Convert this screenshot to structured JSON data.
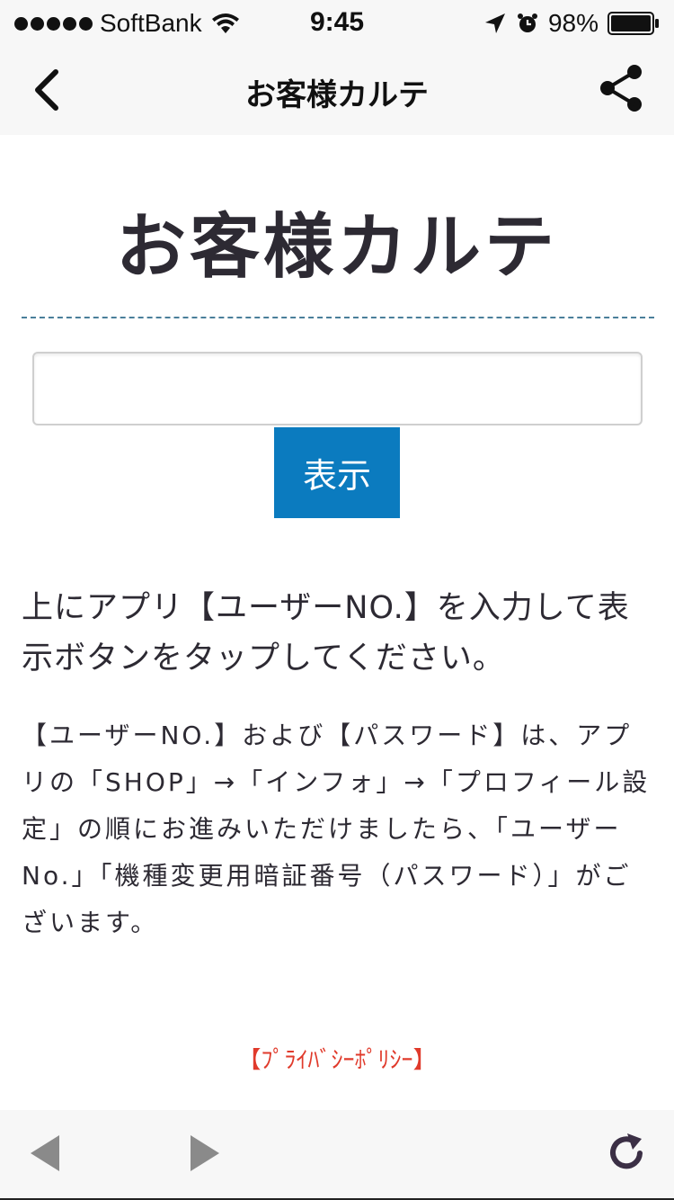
{
  "status_bar": {
    "carrier": "SoftBank",
    "time": "9:45",
    "battery": "98%",
    "signal_dots": 5,
    "icons": [
      "wifi-icon",
      "location-arrow-icon",
      "alarm-icon",
      "battery-icon"
    ]
  },
  "nav": {
    "title": "お客様カルテ",
    "back_icon": "chevron-left-icon",
    "share_icon": "share-icon"
  },
  "main": {
    "heading": "お客様カルテ",
    "input": {
      "value": "",
      "placeholder": ""
    },
    "show_button_label": "表示",
    "instruction": "上にアプリ【ユーザーNO.】を入力して表示ボタンをタップしてください。",
    "note": "【ユーザーNO.】および【パスワード】は、アプリの「SHOP」→「インフォ」→「プロフィール設定」の順にお進みいただけましたら、「ユーザーNo.」「機種変更用暗証番号（パスワード）」がございます。",
    "privacy_link": "【ﾌﾟﾗｲﾊﾞｼｰﾎﾟﾘｼｰ】"
  },
  "toolbar": {
    "icons": [
      "back-arrow-icon",
      "forward-arrow-icon",
      "reload-icon"
    ]
  },
  "colors": {
    "accent": "#0b7bbf",
    "link_red": "#e03a2b",
    "text": "#2d2a33",
    "dotted_rule": "#4a7f9a"
  }
}
